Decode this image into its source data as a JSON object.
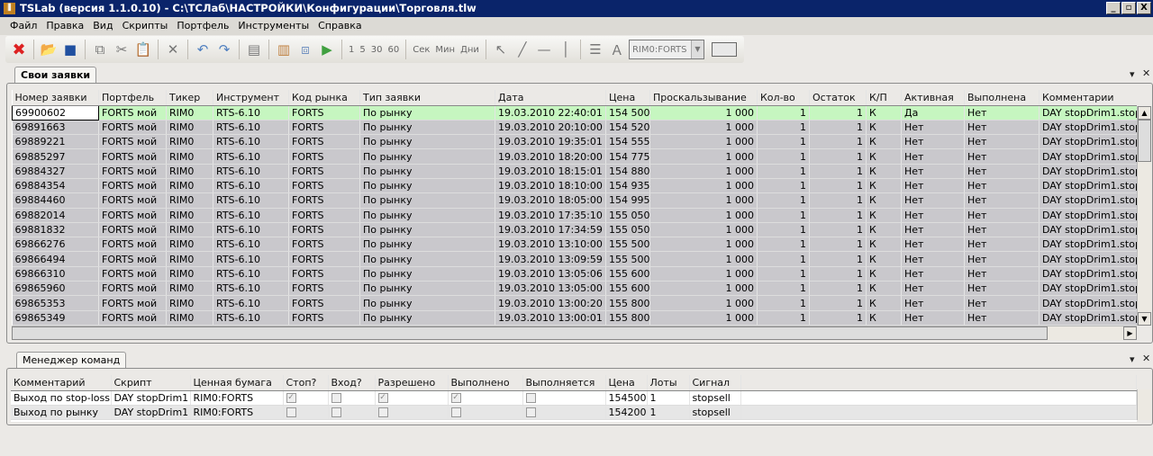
{
  "window": {
    "title": "TSLab (версия 1.1.0.10) - C:\\ТСЛаб\\НАСТРОЙКИ\\Конфигурации\\Торговля.tlw",
    "minimize": "_",
    "restore": "▫",
    "close": "X"
  },
  "menu": [
    "Файл",
    "Правка",
    "Вид",
    "Скрипты",
    "Портфель",
    "Инструменты",
    "Справка"
  ],
  "toolbar": {
    "intervals": [
      "1",
      "5",
      "30",
      "60"
    ],
    "units": [
      "Сек",
      "Мин",
      "Дни"
    ],
    "instrument": "RIM0:FORTS"
  },
  "orders": {
    "tab": "Свои заявки",
    "columns": [
      "Номер заявки",
      "Портфель",
      "Тикер",
      "Инструмент",
      "Код рынка",
      "Тип заявки",
      "Дата",
      "Цена",
      "Проскальзывание",
      "Кол-во",
      "Остаток",
      "К/П",
      "Активная",
      "Выполнена",
      "Комментарии"
    ],
    "rows": [
      [
        "69900602",
        "FORTS мой",
        "RIM0",
        "RTS-6.10",
        "FORTS",
        "По рынку",
        "19.03.2010 22:40:01",
        "154 500",
        "1 000",
        "1",
        "1",
        "К",
        "Да",
        "Нет",
        "DAY stopDrim1.stop"
      ],
      [
        "69891663",
        "FORTS мой",
        "RIM0",
        "RTS-6.10",
        "FORTS",
        "По рынку",
        "19.03.2010 20:10:00",
        "154 520",
        "1 000",
        "1",
        "1",
        "К",
        "Нет",
        "Нет",
        "DAY stopDrim1.stop"
      ],
      [
        "69889221",
        "FORTS мой",
        "RIM0",
        "RTS-6.10",
        "FORTS",
        "По рынку",
        "19.03.2010 19:35:01",
        "154 555",
        "1 000",
        "1",
        "1",
        "К",
        "Нет",
        "Нет",
        "DAY stopDrim1.stop"
      ],
      [
        "69885297",
        "FORTS мой",
        "RIM0",
        "RTS-6.10",
        "FORTS",
        "По рынку",
        "19.03.2010 18:20:00",
        "154 775",
        "1 000",
        "1",
        "1",
        "К",
        "Нет",
        "Нет",
        "DAY stopDrim1.stop"
      ],
      [
        "69884327",
        "FORTS мой",
        "RIM0",
        "RTS-6.10",
        "FORTS",
        "По рынку",
        "19.03.2010 18:15:01",
        "154 880",
        "1 000",
        "1",
        "1",
        "К",
        "Нет",
        "Нет",
        "DAY stopDrim1.stop"
      ],
      [
        "69884354",
        "FORTS мой",
        "RIM0",
        "RTS-6.10",
        "FORTS",
        "По рынку",
        "19.03.2010 18:10:00",
        "154 935",
        "1 000",
        "1",
        "1",
        "К",
        "Нет",
        "Нет",
        "DAY stopDrim1.stop"
      ],
      [
        "69884460",
        "FORTS мой",
        "RIM0",
        "RTS-6.10",
        "FORTS",
        "По рынку",
        "19.03.2010 18:05:00",
        "154 995",
        "1 000",
        "1",
        "1",
        "К",
        "Нет",
        "Нет",
        "DAY stopDrim1.stop"
      ],
      [
        "69882014",
        "FORTS мой",
        "RIM0",
        "RTS-6.10",
        "FORTS",
        "По рынку",
        "19.03.2010 17:35:10",
        "155 050",
        "1 000",
        "1",
        "1",
        "К",
        "Нет",
        "Нет",
        "DAY stopDrim1.stop"
      ],
      [
        "69881832",
        "FORTS мой",
        "RIM0",
        "RTS-6.10",
        "FORTS",
        "По рынку",
        "19.03.2010 17:34:59",
        "155 050",
        "1 000",
        "1",
        "1",
        "К",
        "Нет",
        "Нет",
        "DAY stopDrim1.stop"
      ],
      [
        "69866276",
        "FORTS мой",
        "RIM0",
        "RTS-6.10",
        "FORTS",
        "По рынку",
        "19.03.2010 13:10:00",
        "155 500",
        "1 000",
        "1",
        "1",
        "К",
        "Нет",
        "Нет",
        "DAY stopDrim1.stop"
      ],
      [
        "69866494",
        "FORTS мой",
        "RIM0",
        "RTS-6.10",
        "FORTS",
        "По рынку",
        "19.03.2010 13:09:59",
        "155 500",
        "1 000",
        "1",
        "1",
        "К",
        "Нет",
        "Нет",
        "DAY stopDrim1.stop"
      ],
      [
        "69866310",
        "FORTS мой",
        "RIM0",
        "RTS-6.10",
        "FORTS",
        "По рынку",
        "19.03.2010 13:05:06",
        "155 600",
        "1 000",
        "1",
        "1",
        "К",
        "Нет",
        "Нет",
        "DAY stopDrim1.stop"
      ],
      [
        "69865960",
        "FORTS мой",
        "RIM0",
        "RTS-6.10",
        "FORTS",
        "По рынку",
        "19.03.2010 13:05:00",
        "155 600",
        "1 000",
        "1",
        "1",
        "К",
        "Нет",
        "Нет",
        "DAY stopDrim1.stop"
      ],
      [
        "69865353",
        "FORTS мой",
        "RIM0",
        "RTS-6.10",
        "FORTS",
        "По рынку",
        "19.03.2010 13:00:20",
        "155 800",
        "1 000",
        "1",
        "1",
        "К",
        "Нет",
        "Нет",
        "DAY stopDrim1.stop"
      ],
      [
        "69865349",
        "FORTS мой",
        "RIM0",
        "RTS-6.10",
        "FORTS",
        "По рынку",
        "19.03.2010 13:00:01",
        "155 800",
        "1 000",
        "1",
        "1",
        "К",
        "Нет",
        "Нет",
        "DAY stopDrim1.stop"
      ]
    ]
  },
  "commands": {
    "tab": "Менеджер команд",
    "columns": [
      "Комментарий",
      "Скрипт",
      "Ценная бумага",
      "Стоп?",
      "Вход?",
      "Разрешено",
      "Выполнено",
      "Выполняется",
      "Цена",
      "Лоты",
      "Сигнал"
    ],
    "rows": [
      {
        "comment": "Выход по stop-loss",
        "script": "DAY stopDrim1",
        "security": "RIM0:FORTS",
        "stop": true,
        "entry": false,
        "allowed": true,
        "done": true,
        "executing": false,
        "price": "154500",
        "lots": "1",
        "signal": "stopsell"
      },
      {
        "comment": "Выход по рынку",
        "script": "DAY stopDrim1",
        "security": "RIM0:FORTS",
        "stop": false,
        "entry": false,
        "allowed": false,
        "done": false,
        "executing": false,
        "price": "154200",
        "lots": "1",
        "signal": "stopsell"
      }
    ]
  }
}
